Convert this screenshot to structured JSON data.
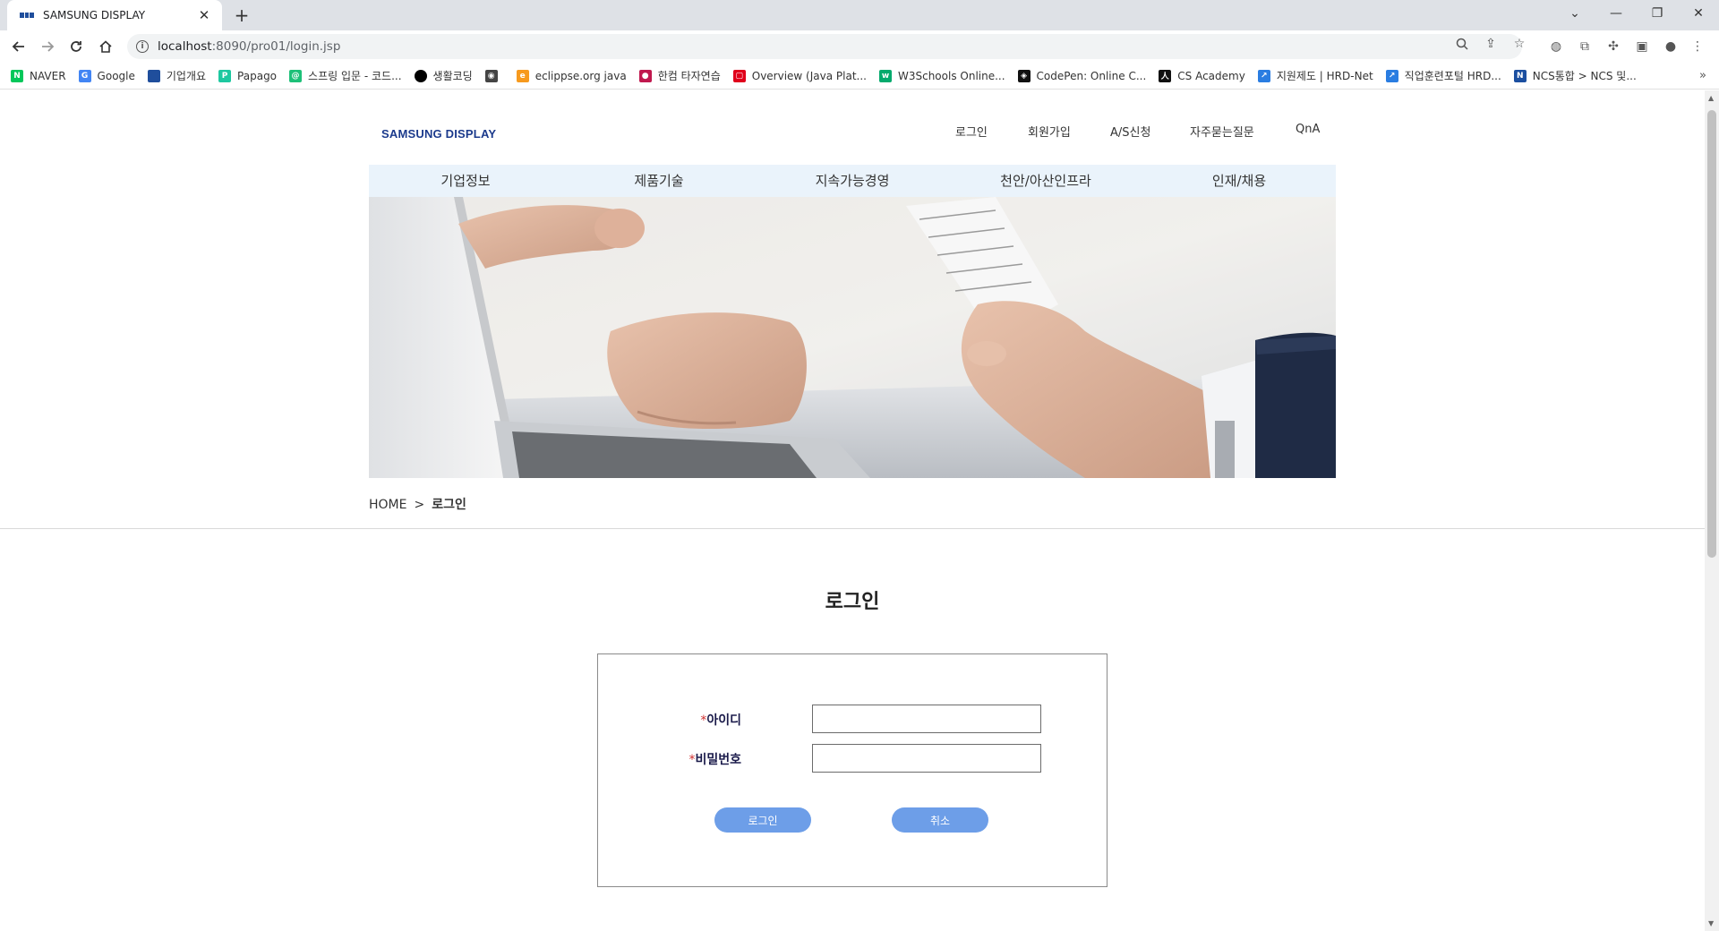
{
  "browser": {
    "tab_title": "SAMSUNG DISPLAY",
    "url_host": "localhost",
    "url_rest": ":8090/pro01/login.jsp",
    "bookmarks": [
      {
        "label": "NAVER",
        "icon": "naver-icon",
        "color": "#03c75a",
        "glyph": "N"
      },
      {
        "label": "Google",
        "icon": "google-icon",
        "color": "#4285f4",
        "glyph": "G"
      },
      {
        "label": "기업개요",
        "icon": "samsung-display-icon",
        "color": "#1f4e9c",
        "glyph": ""
      },
      {
        "label": "Papago",
        "icon": "papago-icon",
        "color": "#1ec8a0",
        "glyph": "P"
      },
      {
        "label": "스프링 입문 - 코드...",
        "icon": "inflearn-icon",
        "color": "#1dc078",
        "glyph": "@"
      },
      {
        "label": "생활코딩",
        "icon": "opentutorials-icon",
        "color": "#000000",
        "glyph": ""
      },
      {
        "label": "",
        "icon": "globe-icon",
        "color": "#444444",
        "glyph": "◉"
      },
      {
        "label": "eclippse.org java",
        "icon": "eclipse-icon",
        "color": "#f79a1e",
        "glyph": "e"
      },
      {
        "label": "한컴 타자연습",
        "icon": "hancom-icon",
        "color": "#c0184e",
        "glyph": "●"
      },
      {
        "label": "Overview (Java Plat...",
        "icon": "oracle-icon",
        "color": "#e0001b",
        "glyph": "▢"
      },
      {
        "label": "W3Schools Online...",
        "icon": "w3schools-icon",
        "color": "#04aa6d",
        "glyph": "w"
      },
      {
        "label": "CodePen: Online C...",
        "icon": "codepen-icon",
        "color": "#111111",
        "glyph": "◈"
      },
      {
        "label": "CS Academy",
        "icon": "cs-academy-icon",
        "color": "#111111",
        "glyph": "人"
      },
      {
        "label": "지원제도 | HRD-Net",
        "icon": "hrd-net-icon",
        "color": "#2a7de1",
        "glyph": "↗"
      },
      {
        "label": "직업훈련포털 HRD...",
        "icon": "hrd-portal-icon",
        "color": "#2a7de1",
        "glyph": "↗"
      },
      {
        "label": "NCS통합 > NCS 및...",
        "icon": "ncs-icon",
        "color": "#1b4fa0",
        "glyph": "N"
      }
    ]
  },
  "site": {
    "brand": "SAMSUNG DISPLAY",
    "top_nav": [
      "로그인",
      "회원가입",
      "A/S신청",
      "자주묻는질문",
      "QnA"
    ],
    "main_nav": [
      "기업정보",
      "제품기술",
      "지속가능경영",
      "천안/아산인프라",
      "인재/채용"
    ],
    "breadcrumb": {
      "home": "HOME",
      "sep": ">",
      "current": "로그인"
    }
  },
  "login": {
    "title": "로그인",
    "id_label": "아이디",
    "pw_label": "비밀번호",
    "required_mark": "*",
    "id_value": "",
    "pw_value": "",
    "login_button": "로그인",
    "cancel_button": "취소"
  },
  "colors": {
    "accent_button": "#6d9ee8",
    "brand": "#1b3a8c",
    "gnb_bg": "#eaf3fb",
    "required": "#d03030"
  }
}
